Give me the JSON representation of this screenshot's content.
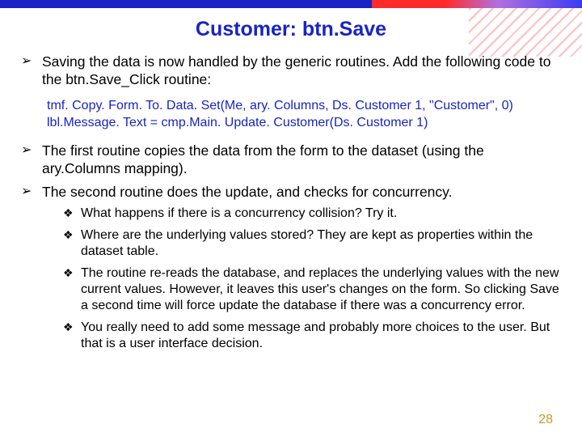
{
  "title": "Customer: btn.Save",
  "bullets1a": "Saving the data is now handled by the generic routines. Add the following code to the btn.Save_Click routine:",
  "code_line1": "tmf. Copy. Form. To. Data. Set(Me, ary. Columns, Ds. Customer 1, \"Customer\", 0)",
  "code_line2": "lbl.Message. Text = cmp.Main. Update. Customer(Ds. Customer 1)",
  "bullets1b": "The first routine copies the data from the form to the dataset (using the ary.Columns mapping).",
  "bullets1c": "The second routine does the update, and checks for concurrency.",
  "sub": {
    "a": "What happens if there is a concurrency collision? Try it.",
    "b": "Where are the underlying values stored? They are kept as properties within the dataset table.",
    "c": "The routine re-reads the database, and replaces the underlying values with the new current values. However, it leaves this user's changes on the form. So clicking Save a second time will force update the database if there was a concurrency error.",
    "d": "You really need to add some message and probably more choices to the user. But that is a user interface decision."
  },
  "page_number": "28"
}
